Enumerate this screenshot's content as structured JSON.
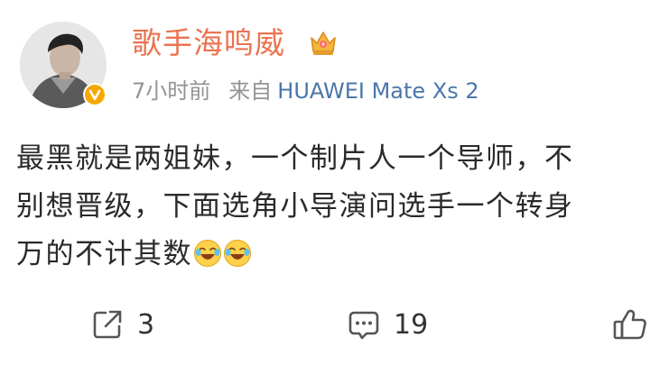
{
  "post": {
    "username": "歌手海鸣威",
    "time": "7小时前",
    "from_label": "来自",
    "device": "HUAWEI Mate Xs 2",
    "content": {
      "line1": "最黑就是两姐妹，一个制片人一个导师，不",
      "line2": "别想晋级，下面选角小导演问选手一个转身",
      "line3": "万的不计其数"
    },
    "emojis": [
      "laugh-cry-icon",
      "laugh-cry-icon"
    ]
  },
  "actions": {
    "repost_count": "3",
    "comment_count": "19"
  },
  "colors": {
    "username": "#eb7350",
    "device_link": "#4a77a9",
    "meta_text": "#939393",
    "verified_badge": "#f6a800",
    "body_text": "#2a2a2a"
  }
}
